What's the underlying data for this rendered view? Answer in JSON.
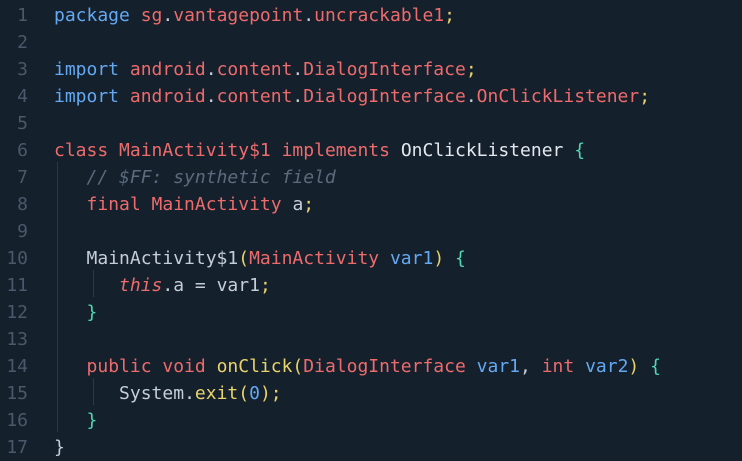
{
  "editor": {
    "lines": [
      {
        "number": "1",
        "tokens": [
          {
            "text": "package ",
            "type": "blue"
          },
          {
            "text": "sg",
            "type": "red"
          },
          {
            "text": ".",
            "type": "plain"
          },
          {
            "text": "vantagepoint",
            "type": "red"
          },
          {
            "text": ".",
            "type": "plain"
          },
          {
            "text": "uncrackable1",
            "type": "red"
          },
          {
            "text": ";",
            "type": "yellow"
          }
        ]
      },
      {
        "number": "2",
        "tokens": []
      },
      {
        "number": "3",
        "tokens": [
          {
            "text": "import ",
            "type": "blue"
          },
          {
            "text": "android",
            "type": "red"
          },
          {
            "text": ".",
            "type": "plain"
          },
          {
            "text": "content",
            "type": "red"
          },
          {
            "text": ".",
            "type": "plain"
          },
          {
            "text": "DialogInterface",
            "type": "red"
          },
          {
            "text": ";",
            "type": "yellow"
          }
        ]
      },
      {
        "number": "4",
        "tokens": [
          {
            "text": "import ",
            "type": "blue"
          },
          {
            "text": "android",
            "type": "red"
          },
          {
            "text": ".",
            "type": "plain"
          },
          {
            "text": "content",
            "type": "red"
          },
          {
            "text": ".",
            "type": "plain"
          },
          {
            "text": "DialogInterface",
            "type": "red"
          },
          {
            "text": ".",
            "type": "plain"
          },
          {
            "text": "OnClickListener",
            "type": "red"
          },
          {
            "text": ";",
            "type": "yellow"
          }
        ]
      },
      {
        "number": "5",
        "tokens": []
      },
      {
        "number": "6",
        "tokens": [
          {
            "text": "class ",
            "type": "red"
          },
          {
            "text": "MainActivity$1 ",
            "type": "red"
          },
          {
            "text": "implements ",
            "type": "red"
          },
          {
            "text": "OnClickListener ",
            "type": "white"
          },
          {
            "text": "{",
            "type": "green"
          }
        ]
      },
      {
        "number": "7",
        "tokens": [
          {
            "text": "   ",
            "type": "plain"
          },
          {
            "text": "// $FF: synthetic field",
            "type": "comment"
          }
        ]
      },
      {
        "number": "8",
        "tokens": [
          {
            "text": "   ",
            "type": "plain"
          },
          {
            "text": "final ",
            "type": "red"
          },
          {
            "text": "MainActivity ",
            "type": "red"
          },
          {
            "text": "a",
            "type": "plain"
          },
          {
            "text": ";",
            "type": "yellow"
          }
        ]
      },
      {
        "number": "9",
        "tokens": []
      },
      {
        "number": "10",
        "tokens": [
          {
            "text": "   ",
            "type": "plain"
          },
          {
            "text": "MainActivity$1",
            "type": "plain"
          },
          {
            "text": "(",
            "type": "yellow"
          },
          {
            "text": "MainActivity ",
            "type": "red"
          },
          {
            "text": "var1",
            "type": "blue"
          },
          {
            "text": ") ",
            "type": "yellow"
          },
          {
            "text": "{",
            "type": "green"
          }
        ]
      },
      {
        "number": "11",
        "tokens": [
          {
            "text": "      ",
            "type": "plain"
          },
          {
            "text": "this",
            "type": "this"
          },
          {
            "text": ".a = var1",
            "type": "plain"
          },
          {
            "text": ";",
            "type": "yellow"
          }
        ]
      },
      {
        "number": "12",
        "tokens": [
          {
            "text": "   ",
            "type": "plain"
          },
          {
            "text": "}",
            "type": "green"
          }
        ]
      },
      {
        "number": "13",
        "tokens": []
      },
      {
        "number": "14",
        "tokens": [
          {
            "text": "   ",
            "type": "plain"
          },
          {
            "text": "public ",
            "type": "red"
          },
          {
            "text": "void ",
            "type": "red"
          },
          {
            "text": "onClick",
            "type": "yellow"
          },
          {
            "text": "(",
            "type": "yellow"
          },
          {
            "text": "DialogInterface ",
            "type": "red"
          },
          {
            "text": "var1",
            "type": "blue"
          },
          {
            "text": ", ",
            "type": "plain"
          },
          {
            "text": "int ",
            "type": "red"
          },
          {
            "text": "var2",
            "type": "blue"
          },
          {
            "text": ") ",
            "type": "yellow"
          },
          {
            "text": "{",
            "type": "green"
          }
        ]
      },
      {
        "number": "15",
        "tokens": [
          {
            "text": "      ",
            "type": "plain"
          },
          {
            "text": "System",
            "type": "plain"
          },
          {
            "text": ".",
            "type": "plain"
          },
          {
            "text": "exit",
            "type": "yellow"
          },
          {
            "text": "(",
            "type": "yellow"
          },
          {
            "text": "0",
            "type": "blue"
          },
          {
            "text": ");",
            "type": "yellow"
          }
        ]
      },
      {
        "number": "16",
        "tokens": [
          {
            "text": "   ",
            "type": "plain"
          },
          {
            "text": "}",
            "type": "green"
          }
        ]
      },
      {
        "number": "17",
        "tokens": [
          {
            "text": "}",
            "type": "plain"
          }
        ]
      }
    ]
  },
  "colors": {
    "background": "#15202d",
    "keyword": "#ee6b6b",
    "import_keyword": "#63a9f2",
    "method": "#e9d36a",
    "bracket": "#4fd8b0",
    "comment": "#5b6b7c",
    "line_number": "#4b5869"
  }
}
